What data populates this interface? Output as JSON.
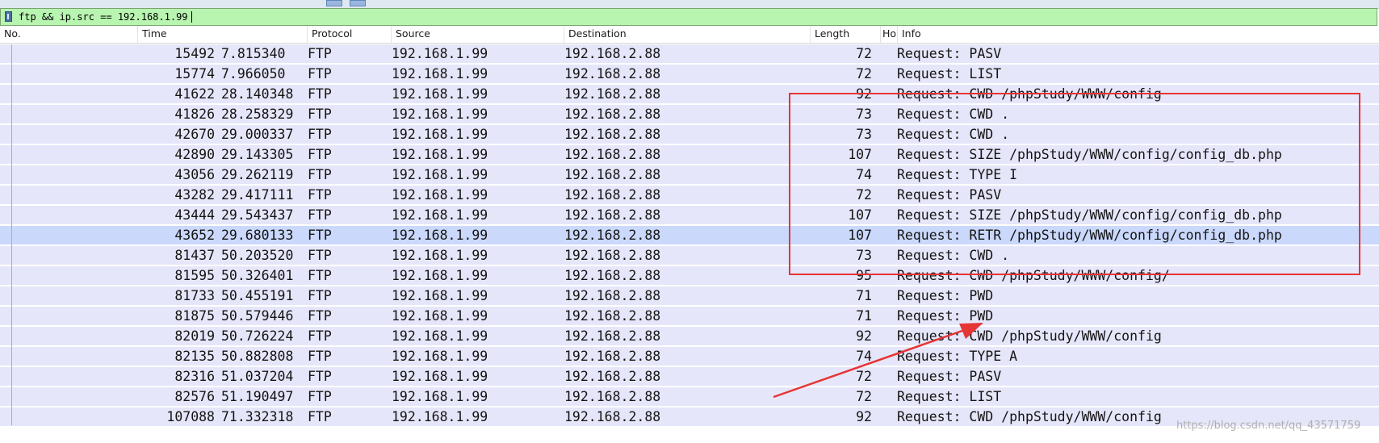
{
  "filter": {
    "value": "ftp && ip.src == 192.168.1.99"
  },
  "columns": {
    "no": "No.",
    "time": "Time",
    "protocol": "Protocol",
    "source": "Source",
    "destination": "Destination",
    "length": "Length",
    "ho": "Ho",
    "info": "Info"
  },
  "selected_row_index": 9,
  "packets": [
    {
      "no": "15492",
      "time": "7.815340",
      "protocol": "FTP",
      "source": "192.168.1.99",
      "destination": "192.168.2.88",
      "length": "72",
      "info": "Request: PASV"
    },
    {
      "no": "15774",
      "time": "7.966050",
      "protocol": "FTP",
      "source": "192.168.1.99",
      "destination": "192.168.2.88",
      "length": "72",
      "info": "Request: LIST"
    },
    {
      "no": "41622",
      "time": "28.140348",
      "protocol": "FTP",
      "source": "192.168.1.99",
      "destination": "192.168.2.88",
      "length": "92",
      "info": "Request: CWD /phpStudy/WWW/config"
    },
    {
      "no": "41826",
      "time": "28.258329",
      "protocol": "FTP",
      "source": "192.168.1.99",
      "destination": "192.168.2.88",
      "length": "73",
      "info": "Request: CWD ."
    },
    {
      "no": "42670",
      "time": "29.000337",
      "protocol": "FTP",
      "source": "192.168.1.99",
      "destination": "192.168.2.88",
      "length": "73",
      "info": "Request: CWD ."
    },
    {
      "no": "42890",
      "time": "29.143305",
      "protocol": "FTP",
      "source": "192.168.1.99",
      "destination": "192.168.2.88",
      "length": "107",
      "info": "Request: SIZE /phpStudy/WWW/config/config_db.php"
    },
    {
      "no": "43056",
      "time": "29.262119",
      "protocol": "FTP",
      "source": "192.168.1.99",
      "destination": "192.168.2.88",
      "length": "74",
      "info": "Request: TYPE I"
    },
    {
      "no": "43282",
      "time": "29.417111",
      "protocol": "FTP",
      "source": "192.168.1.99",
      "destination": "192.168.2.88",
      "length": "72",
      "info": "Request: PASV"
    },
    {
      "no": "43444",
      "time": "29.543437",
      "protocol": "FTP",
      "source": "192.168.1.99",
      "destination": "192.168.2.88",
      "length": "107",
      "info": "Request: SIZE /phpStudy/WWW/config/config_db.php"
    },
    {
      "no": "43652",
      "time": "29.680133",
      "protocol": "FTP",
      "source": "192.168.1.99",
      "destination": "192.168.2.88",
      "length": "107",
      "info": "Request: RETR /phpStudy/WWW/config/config_db.php"
    },
    {
      "no": "81437",
      "time": "50.203520",
      "protocol": "FTP",
      "source": "192.168.1.99",
      "destination": "192.168.2.88",
      "length": "73",
      "info": "Request: CWD ."
    },
    {
      "no": "81595",
      "time": "50.326401",
      "protocol": "FTP",
      "source": "192.168.1.99",
      "destination": "192.168.2.88",
      "length": "95",
      "info": "Request: CWD /phpStudy/WWW/config/"
    },
    {
      "no": "81733",
      "time": "50.455191",
      "protocol": "FTP",
      "source": "192.168.1.99",
      "destination": "192.168.2.88",
      "length": "71",
      "info": "Request: PWD"
    },
    {
      "no": "81875",
      "time": "50.579446",
      "protocol": "FTP",
      "source": "192.168.1.99",
      "destination": "192.168.2.88",
      "length": "71",
      "info": "Request: PWD"
    },
    {
      "no": "82019",
      "time": "50.726224",
      "protocol": "FTP",
      "source": "192.168.1.99",
      "destination": "192.168.2.88",
      "length": "92",
      "info": "Request: CWD /phpStudy/WWW/config"
    },
    {
      "no": "82135",
      "time": "50.882808",
      "protocol": "FTP",
      "source": "192.168.1.99",
      "destination": "192.168.2.88",
      "length": "74",
      "info": "Request: TYPE A"
    },
    {
      "no": "82316",
      "time": "51.037204",
      "protocol": "FTP",
      "source": "192.168.1.99",
      "destination": "192.168.2.88",
      "length": "72",
      "info": "Request: PASV"
    },
    {
      "no": "82576",
      "time": "51.190497",
      "protocol": "FTP",
      "source": "192.168.1.99",
      "destination": "192.168.2.88",
      "length": "72",
      "info": "Request: LIST"
    },
    {
      "no": "107088",
      "time": "71.332318",
      "protocol": "FTP",
      "source": "192.168.1.99",
      "destination": "192.168.2.88",
      "length": "92",
      "info": "Request: CWD /phpStudy/WWW/config"
    }
  ],
  "annotation": {
    "box_color": "#e53535",
    "arrow_color": "#e53535"
  },
  "watermark": "https://blog.csdn.net/qq_43571759",
  "colors": {
    "row_bg": "#e6e6fa",
    "selected_row_bg": "#cad8fb",
    "filter_bg": "#b8f5b0"
  }
}
